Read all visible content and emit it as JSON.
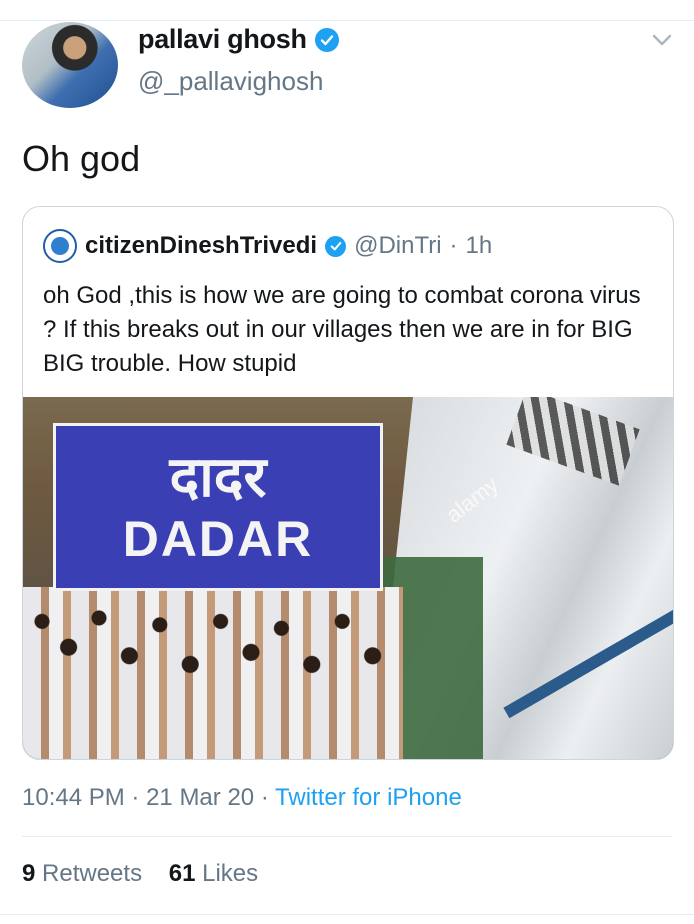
{
  "tweet": {
    "display_name": "pallavi ghosh",
    "handle": "@_pallavighosh",
    "text": "Oh god",
    "timestamp": "10:44 PM",
    "date": "21 Mar 20",
    "source": "Twitter for iPhone",
    "meta_separator": "·",
    "retweets_count": "9",
    "retweets_label": "Retweets",
    "likes_count": "61",
    "likes_label": "Likes"
  },
  "quoted": {
    "display_name": "citizenDineshTrivedi",
    "handle": "@DinTri",
    "separator": "·",
    "time": "1h",
    "text": "oh God  ,this is how we are going to combat corona virus ? If this breaks out in our villages then we are in for BIG BIG trouble. How stupid",
    "image": {
      "sign_hindi": "दादर",
      "sign_english": "DADAR",
      "watermark": "alamy"
    }
  },
  "colors": {
    "accent": "#1da1f2",
    "text": "#14171a",
    "secondary": "#657786",
    "sign_blue": "#3b3fb4"
  },
  "icons": {
    "verified": "verified-badge-icon",
    "chevron": "chevron-down-icon"
  }
}
